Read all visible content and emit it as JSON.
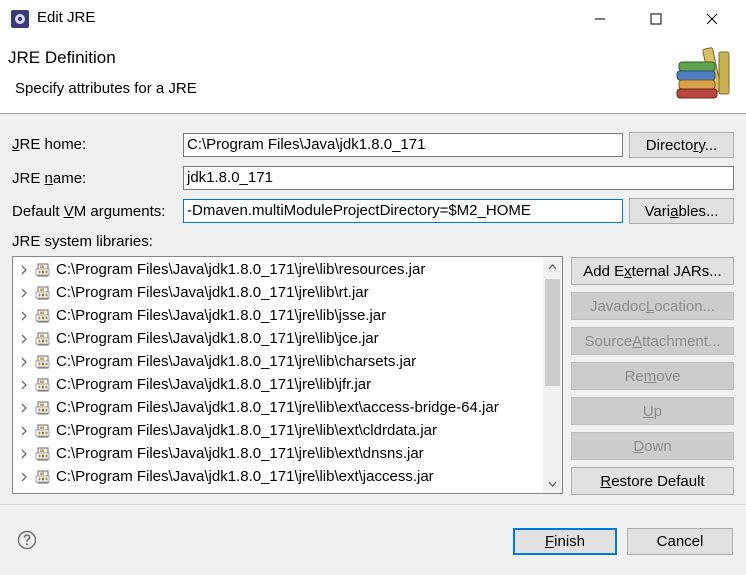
{
  "window": {
    "title": "Edit JRE",
    "app_icon": "eclipse-gear-icon"
  },
  "header": {
    "title": "JRE Definition",
    "description": "Specify attributes for a JRE",
    "image": "library-books-icon"
  },
  "form": {
    "jre_home": {
      "label_prefix": "",
      "label_mnemonic": "J",
      "label_rest": "RE home:",
      "value": "C:\\Program Files\\Java\\jdk1.8.0_171",
      "button_pre": "Directo",
      "button_mnemonic": "r",
      "button_post": "y..."
    },
    "jre_name": {
      "label_prefix": "JRE ",
      "label_mnemonic": "n",
      "label_rest": "ame:",
      "value": "jdk1.8.0_171"
    },
    "vm_args": {
      "label_prefix": "Default ",
      "label_mnemonic": "V",
      "label_rest": "M arguments:",
      "value": "-Dmaven.multiModuleProjectDirectory=$M2_HOME",
      "button_pre": "Vari",
      "button_mnemonic": "a",
      "button_post": "bles..."
    },
    "libraries_label": "JRE system libraries:"
  },
  "libraries": [
    "C:\\Program Files\\Java\\jdk1.8.0_171\\jre\\lib\\resources.jar",
    "C:\\Program Files\\Java\\jdk1.8.0_171\\jre\\lib\\rt.jar",
    "C:\\Program Files\\Java\\jdk1.8.0_171\\jre\\lib\\jsse.jar",
    "C:\\Program Files\\Java\\jdk1.8.0_171\\jre\\lib\\jce.jar",
    "C:\\Program Files\\Java\\jdk1.8.0_171\\jre\\lib\\charsets.jar",
    "C:\\Program Files\\Java\\jdk1.8.0_171\\jre\\lib\\jfr.jar",
    "C:\\Program Files\\Java\\jdk1.8.0_171\\jre\\lib\\ext\\access-bridge-64.jar",
    "C:\\Program Files\\Java\\jdk1.8.0_171\\jre\\lib\\ext\\cldrdata.jar",
    "C:\\Program Files\\Java\\jdk1.8.0_171\\jre\\lib\\ext\\dnsns.jar",
    "C:\\Program Files\\Java\\jdk1.8.0_171\\jre\\lib\\ext\\jaccess.jar"
  ],
  "side_buttons": {
    "add_external": {
      "pre": "Add E",
      "mn": "x",
      "post": "ternal JARs..."
    },
    "javadoc": {
      "pre": "Javadoc ",
      "mn": "L",
      "post": "ocation..."
    },
    "source": {
      "pre": "Source ",
      "mn": "A",
      "post": "ttachment..."
    },
    "remove": {
      "pre": "Re",
      "mn": "m",
      "post": "ove"
    },
    "up": {
      "pre": "",
      "mn": "U",
      "post": "p"
    },
    "down": {
      "pre": "",
      "mn": "D",
      "post": "own"
    },
    "restore": {
      "pre": "",
      "mn": "R",
      "post": "estore Default"
    }
  },
  "footer": {
    "help_icon": "help-icon",
    "finish": {
      "pre": "",
      "mn": "F",
      "post": "inish"
    },
    "cancel": "Cancel"
  },
  "colors": {
    "focus_border": "#0078d7",
    "background": "#f0f0f0"
  }
}
